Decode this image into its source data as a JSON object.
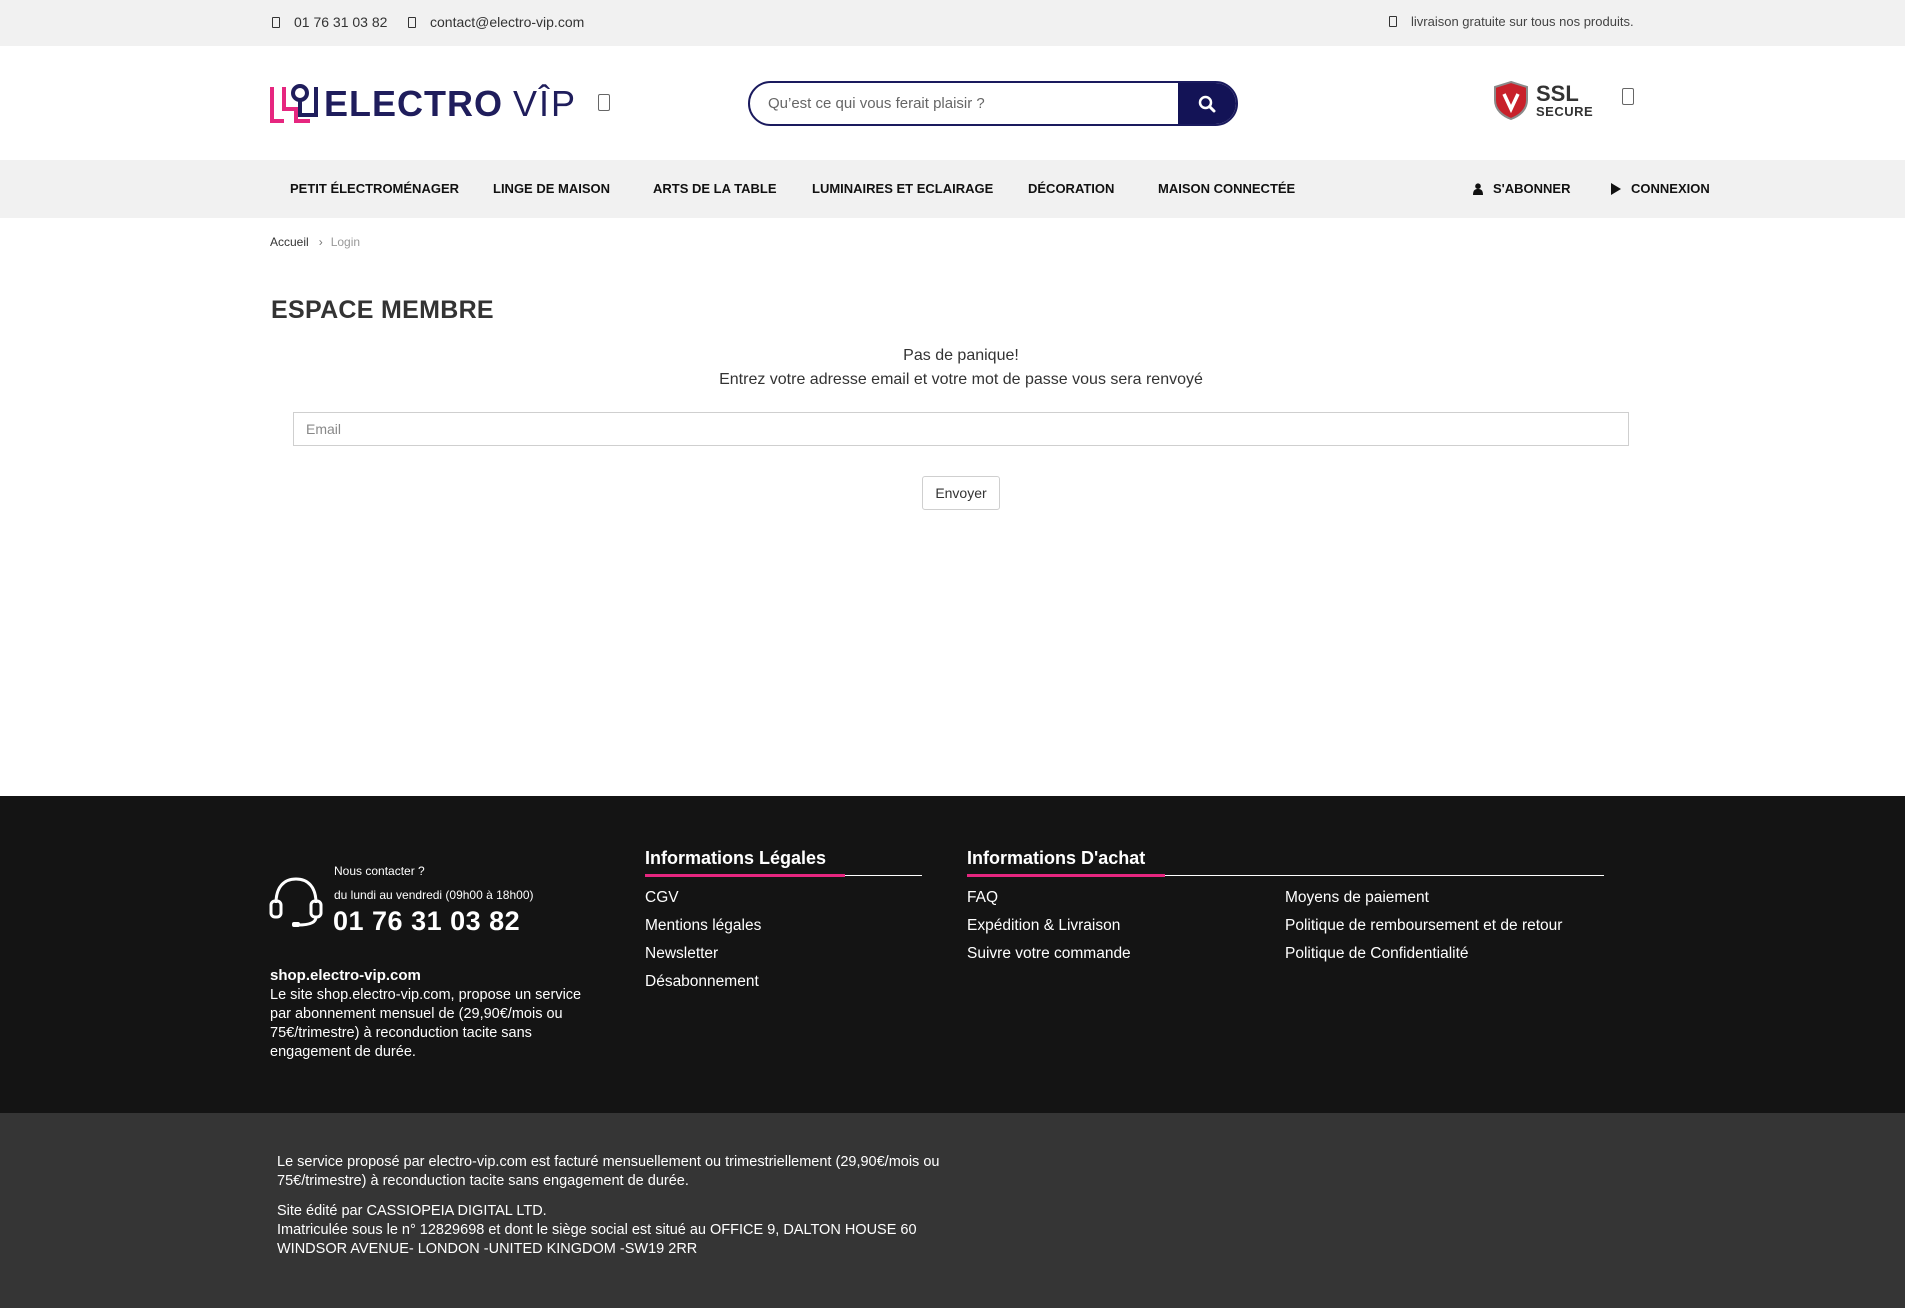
{
  "topbar": {
    "phone": "01 76 31 03 82",
    "email": "contact@electro-vip.com",
    "shipping": "livraison gratuite sur tous nos produits."
  },
  "header": {
    "logo_electro": "ELECTRO",
    "logo_vip": "VÎP",
    "search_placeholder": "Qu’est ce qui vous ferait plaisir ?",
    "ssl_big": "SSL",
    "ssl_small": "SECURE",
    "icons": [
      "search-icon",
      "shield-icon",
      "cart-icon"
    ]
  },
  "nav": {
    "items": [
      "PETIT ÉLECTROMÉNAGER",
      "LINGE DE MAISON",
      "ARTS DE LA TABLE",
      "LUMINAIRES ET ECLAIRAGE",
      "DÉCORATION",
      "MAISON CONNECTÉE"
    ],
    "subscribe": "S'ABONNER",
    "login": "CONNEXION"
  },
  "breadcrumb": {
    "home": "Accueil",
    "current": "Login"
  },
  "main": {
    "title": "ESPACE MEMBRE",
    "message_1": "Pas de panique!",
    "message_2": "Entrez votre adresse email et votre mot de passe vous sera renvoyé",
    "email_placeholder": "Email",
    "submit_label": "Envoyer"
  },
  "footer": {
    "contact_label": "Nous contacter ?",
    "contact_hours": "du lundi au vendredi (09h00 à 18h00)",
    "contact_phone": "01 76 31 03 82",
    "site_name": "shop.electro-vip.com",
    "site_desc": "Le site shop.electro-vip.com, propose un service par abonnement mensuel de (29,90€/mois ou 75€/trimestre) à reconduction tacite sans engagement de durée.",
    "legal_title": "Informations Légales",
    "legal_links": [
      "CGV",
      "Mentions légales",
      "Newsletter",
      "Désabonnement"
    ],
    "purchase_title": "Informations D'achat",
    "purchase_links_col1": [
      "FAQ",
      "Expédition & Livraison",
      "Suivre votre commande"
    ],
    "purchase_links_col2": [
      "Moyens de paiement",
      "Politique de remboursement et de retour",
      "Politique de Confidentialité"
    ],
    "accent_color": "#e6267f"
  },
  "bottom": {
    "line_1": "Le service proposé par electro-vip.com est facturé mensuellement ou trimestriellement (29,90€/mois ou",
    "line_2": "75€/trimestre) à reconduction tacite sans engagement de durée.",
    "line_3": "Site édité par CASSIOPEIA DIGITAL LTD.",
    "line_4": "Imatriculée sous le n° 12829698 et dont le siège social est situé au  OFFICE 9, DALTON HOUSE 60",
    "line_5": "WINDSOR AVENUE- LONDON -UNITED KINGDOM -SW19 2RR"
  },
  "colors": {
    "brand_navy": "#1f1d5c",
    "search_button": "#131356",
    "footer_bg": "#141414",
    "bottom_bg": "#353535"
  }
}
